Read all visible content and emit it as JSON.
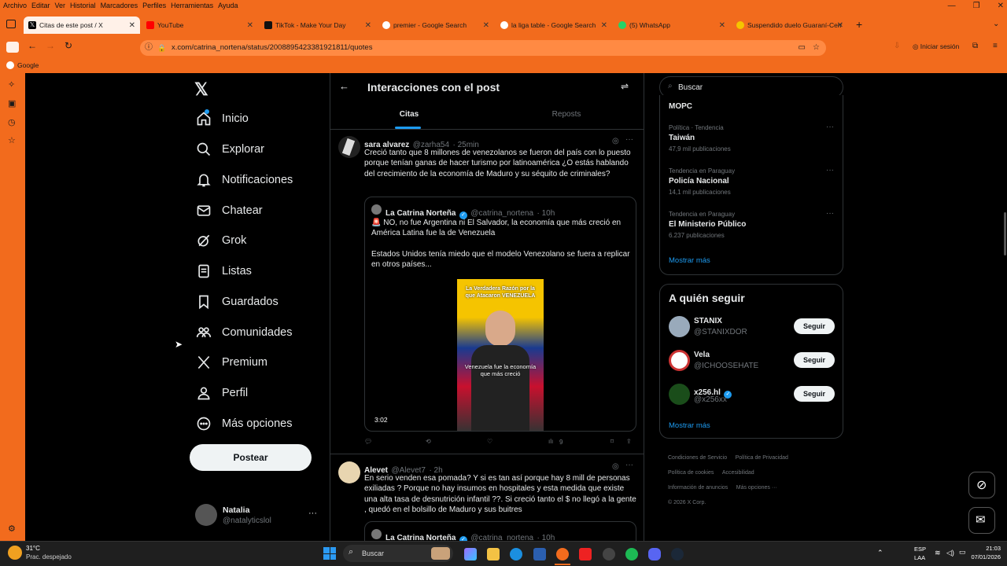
{
  "browser": {
    "menu": [
      "Archivo",
      "Editar",
      "Ver",
      "Historial",
      "Marcadores",
      "Perfiles",
      "Herramientas",
      "Ayuda"
    ],
    "tabs": [
      {
        "label": "Citas de este post / X",
        "color": "#000000",
        "icon": "x-logo-icon"
      },
      {
        "label": "YouTube",
        "color": "#ff0000",
        "icon": "youtube-icon"
      },
      {
        "label": "TikTok - Make Your Day",
        "color": "#111111",
        "icon": "tiktok-icon"
      },
      {
        "label": "premier - Google Search",
        "color": "#ffffff",
        "icon": "google-icon"
      },
      {
        "label": "la liga table - Google Search",
        "color": "#ffffff",
        "icon": "google-icon"
      },
      {
        "label": "(5) WhatsApp",
        "color": "#25d366",
        "icon": "whatsapp-icon"
      },
      {
        "label": "Suspendido duelo Guaraní-Cerr",
        "color": "#f5c400",
        "icon": "news-icon"
      }
    ],
    "url": "x.com/catrina_nortena/status/2008895423381921811/quotes",
    "signin": "Iniciar sesión",
    "bookmark": "Google"
  },
  "nav": {
    "items": [
      {
        "label": "Inicio",
        "icon": "home-icon"
      },
      {
        "label": "Explorar",
        "icon": "search-icon"
      },
      {
        "label": "Notificaciones",
        "icon": "bell-icon"
      },
      {
        "label": "Chatear",
        "icon": "mail-icon"
      },
      {
        "label": "Grok",
        "icon": "grok-icon"
      },
      {
        "label": "Listas",
        "icon": "list-icon"
      },
      {
        "label": "Guardados",
        "icon": "bookmark-icon"
      },
      {
        "label": "Comunidades",
        "icon": "communities-icon"
      },
      {
        "label": "Premium",
        "icon": "x-logo-icon"
      },
      {
        "label": "Perfil",
        "icon": "person-icon"
      },
      {
        "label": "Más opciones",
        "icon": "more-circle-icon"
      }
    ],
    "post_button": "Postear",
    "user": {
      "name": "Natalia",
      "handle": "@natalyticslol"
    }
  },
  "feed": {
    "title": "Interacciones con el post",
    "tabs": [
      "Citas",
      "Reposts"
    ],
    "posts": [
      {
        "name": "sara alvarez",
        "handle": "@zarha54",
        "time": "· 25min",
        "text": "Creció tanto que 8 millones de venezolanos se fueron del país con lo puesto porque tenían ganas de hacer turismo por latinoamérica ¿O estás hablando del crecimiento de la economía de Maduro y su séquito de criminales?",
        "quote": {
          "name": "La Catrina Norteña",
          "handle": "@catrina_nortena",
          "time": "· 10h",
          "text1": "🚨 NO, no fue Argentina ni El Salvador, la economía que más creció en América Latina fue la de Venezuela",
          "text2": "Estados Unidos tenía miedo que el modelo Venezolano se fuera a replicar en otros países...",
          "video_caption_top": "La Verdadera Razón por la que Atacaron VENEZUELA",
          "video_caption_bottom": "Venezuela fue la economía que más creció",
          "duration": "3:02"
        },
        "views": "9"
      },
      {
        "name": "Alevet",
        "handle": "@Alevet7",
        "time": "· 2h",
        "text": "En serio venden esa pomada? Y si es tan así porque hay 8 mill de personas exiliadas ? Porque no hay insumos en hospitales y esta medida que existe una alta tasa de desnutrición infantil ??. Si creció tanto el $ no llegó a la gente , quedó en el bolsillo de Maduro y sus buitres",
        "quote": {
          "name": "La Catrina Norteña",
          "handle": "@catrina_nortena",
          "time": "· 10h"
        }
      }
    ]
  },
  "right": {
    "search_placeholder": "Buscar",
    "trends_top": "MOPC",
    "trends": [
      {
        "meta": "Política · Tendencia",
        "title": "Taiwán",
        "count": "47,9 mil publicaciones"
      },
      {
        "meta": "Tendencia en Paraguay",
        "title": "Policía Nacional",
        "count": "14,1 mil publicaciones"
      },
      {
        "meta": "Tendencia en Paraguay",
        "title": "El Ministerio Público",
        "count": "6.237 publicaciones"
      }
    ],
    "show_more": "Mostrar más",
    "follow_title": "A quién seguir",
    "follow": [
      {
        "name": "STANIX",
        "handle": "@STANIXDOR",
        "btn": "Seguir",
        "avatar_color": "#9ab"
      },
      {
        "name": "Vela",
        "handle": "@ICHOOSEHATE",
        "btn": "Seguir",
        "avatar_color": "#c33"
      },
      {
        "name": "x256.hl",
        "handle": "@x256xx",
        "btn": "Seguir",
        "avatar_color": "#1a4d1a"
      }
    ],
    "show_more2": "Mostrar más",
    "footer": [
      "Condiciones de Servicio",
      "Política de Privacidad",
      "Política de cookies",
      "Accesibilidad",
      "Información de anuncios",
      "Más opciones ···",
      "© 2026 X Corp."
    ]
  },
  "taskbar": {
    "weather_temp": "31°C",
    "weather_desc": "Prac. despejado",
    "search": "Buscar",
    "lang1": "ESP",
    "lang2": "LAA",
    "time": "21:03",
    "date": "07/01/2026"
  }
}
